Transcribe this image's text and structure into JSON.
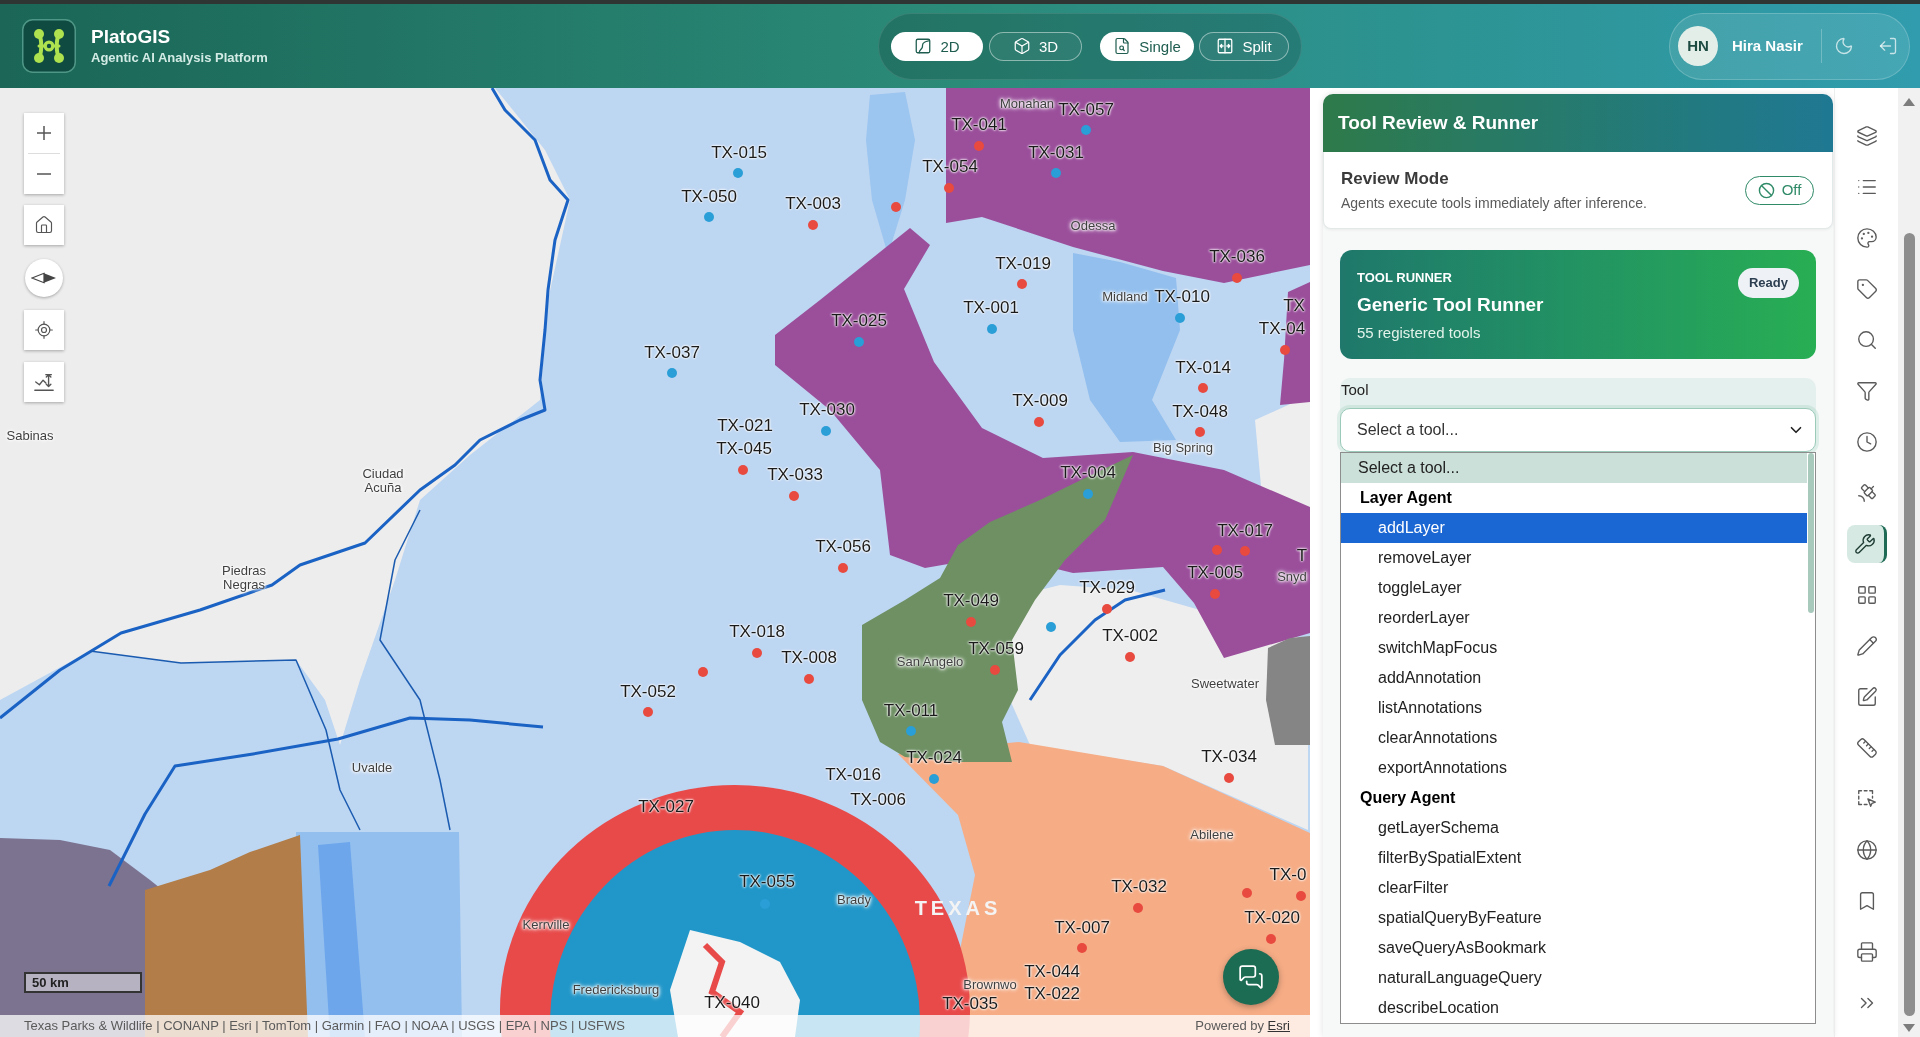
{
  "header": {
    "app_name": "PlatoGIS",
    "tagline": "Agentic AI Analysis Platform",
    "view_modes": [
      {
        "label": "2D",
        "selected": true
      },
      {
        "label": "3D",
        "selected": false
      }
    ],
    "layout_modes": [
      {
        "label": "Single",
        "selected": true
      },
      {
        "label": "Split",
        "selected": false
      }
    ],
    "user": {
      "initials": "HN",
      "name": "Hira Nasir"
    }
  },
  "map": {
    "points": [
      {
        "label": "TX-057",
        "color": "#2a9ed6"
      },
      {
        "label": "TX-041",
        "color": "#e84a3f"
      },
      {
        "label": "TX-015",
        "color": "#2a9ed6"
      },
      {
        "label": "TX-031",
        "color": "#2a9ed6"
      },
      {
        "label": "TX-054",
        "color": "#e84a3f"
      },
      {
        "label": "TX-050",
        "color": "#2a9ed6"
      },
      {
        "label": "TX-003",
        "color": "#e84a3f"
      },
      {
        "color": "#e84a3f"
      },
      {
        "label": "TX-036",
        "color": "#e84a3f"
      },
      {
        "label": "TX-019",
        "color": "#e84a3f"
      },
      {
        "label": "TX-010",
        "color": "#2a9ed6"
      },
      {
        "label": "TX"
      },
      {
        "label": "TX-001",
        "color": "#2a9ed6"
      },
      {
        "label": "TX-025",
        "color": "#2a9ed6"
      },
      {
        "label": "TX-04",
        "color": "#e84a3f"
      },
      {
        "label": "TX-037",
        "color": "#2a9ed6"
      },
      {
        "label": "TX-014",
        "color": "#e84a3f"
      },
      {
        "label": "TX-009",
        "color": "#e84a3f"
      },
      {
        "label": "TX-030",
        "color": "#2a9ed6"
      },
      {
        "label": "TX-048",
        "color": "#e84a3f"
      },
      {
        "label": "TX-021"
      },
      {
        "label": "TX-045",
        "color": "#e84a3f"
      },
      {
        "label": "TX-004",
        "color": "#2a9ed6"
      },
      {
        "label": "TX-033",
        "color": "#e84a3f"
      },
      {
        "label": "TX-017",
        "color": "#e84a3f"
      },
      {
        "color": "#e84a3f"
      },
      {
        "label": "TX-056",
        "color": "#e84a3f"
      },
      {
        "label": "T"
      },
      {
        "label": "TX-005",
        "color": "#e84a3f"
      },
      {
        "label": "TX-029",
        "color": "#e84a3f"
      },
      {
        "label": "TX-049",
        "color": "#e84a3f"
      },
      {
        "color": "#2a9ed6"
      },
      {
        "label": "TX-018",
        "color": "#e84a3f"
      },
      {
        "label": "TX-002",
        "color": "#e84a3f"
      },
      {
        "label": "TX-059",
        "color": "#e84a3f"
      },
      {
        "label": "TX-008",
        "color": "#e84a3f"
      },
      {
        "color": "#e84a3f"
      },
      {
        "label": "TX-052",
        "color": "#e84a3f"
      },
      {
        "label": "TX-011",
        "color": "#2a9ed6"
      },
      {
        "label": "TX-034",
        "color": "#e84a3f"
      },
      {
        "label": "TX-024",
        "color": "#2a9ed6"
      },
      {
        "label": "TX-016"
      },
      {
        "label": "TX-006"
      },
      {
        "label": "TX-027"
      },
      {
        "label": "TX-0",
        "color": "#e84a3f"
      },
      {
        "color": "#e84a3f"
      },
      {
        "label": "TX-055",
        "color": "#2a9ed6"
      },
      {
        "label": "TX-032",
        "color": "#e84a3f"
      },
      {
        "label": "TX-020",
        "color": "#e84a3f"
      },
      {
        "label": "TX-007",
        "color": "#e84a3f"
      },
      {
        "label": "TX-044"
      },
      {
        "label": "TX-022"
      },
      {
        "label": "TX-035"
      },
      {
        "label": "TX-040"
      }
    ],
    "places": [
      {
        "kind": "city",
        "name": "Monahan"
      },
      {
        "kind": "city",
        "name": "Odessa"
      },
      {
        "kind": "city",
        "name": "Midland"
      },
      {
        "kind": "city",
        "name": "Sabinas"
      },
      {
        "kind": "city",
        "name": "Big Spring"
      },
      {
        "kind": "city",
        "name": "Ciudad Acuña"
      },
      {
        "kind": "city",
        "name": "Piedras Negras"
      },
      {
        "kind": "city",
        "name": "Snyd"
      },
      {
        "kind": "city",
        "name": "San Angelo"
      },
      {
        "kind": "city",
        "name": "Sweetwater"
      },
      {
        "kind": "city",
        "name": "Uvalde"
      },
      {
        "kind": "city",
        "name": "Abilene"
      },
      {
        "kind": "region",
        "name": "TEXAS"
      },
      {
        "kind": "city",
        "name": "Brady"
      },
      {
        "kind": "city",
        "name": "Kerrville"
      },
      {
        "kind": "city",
        "name": "Brownwo"
      },
      {
        "kind": "city",
        "name": "Fredericksburg"
      }
    ],
    "scale_label": "50 km",
    "attribution": "Texas Parks & Wildlife | CONANP | Esri | TomTom | Garmin | FAO | NOAA | USGS | EPA | NPS | USFWS",
    "powered_by": "Powered by",
    "powered_by_link": "Esri"
  },
  "panel": {
    "title": "Tool Review & Runner",
    "review_mode": {
      "title": "Review Mode",
      "description": "Agents execute tools immediately after inference.",
      "on": false,
      "toggle_label": "Off"
    },
    "runner": {
      "eyebrow": "TOOL RUNNER",
      "title": "Generic Tool Runner",
      "subtitle": "55 registered tools",
      "status": "Ready"
    },
    "tool_field": {
      "label": "Tool",
      "placeholder": "Select a tool...",
      "expanded": true
    },
    "tool_options": [
      {
        "kind": "option",
        "label": "Select a tool...",
        "selected": true,
        "highlighted": false
      },
      {
        "kind": "group",
        "label": "Layer Agent",
        "children": [
          {
            "kind": "option",
            "label": "addLayer",
            "selected": false,
            "highlighted": true
          },
          {
            "kind": "option",
            "label": "removeLayer",
            "selected": false,
            "highlighted": false
          },
          {
            "kind": "option",
            "label": "toggleLayer",
            "selected": false,
            "highlighted": false
          },
          {
            "kind": "option",
            "label": "reorderLayer",
            "selected": false,
            "highlighted": false
          },
          {
            "kind": "option",
            "label": "switchMapFocus",
            "selected": false,
            "highlighted": false
          },
          {
            "kind": "option",
            "label": "addAnnotation",
            "selected": false,
            "highlighted": false
          },
          {
            "kind": "option",
            "label": "listAnnotations",
            "selected": false,
            "highlighted": false
          },
          {
            "kind": "option",
            "label": "clearAnnotations",
            "selected": false,
            "highlighted": false
          },
          {
            "kind": "option",
            "label": "exportAnnotations",
            "selected": false,
            "highlighted": false
          }
        ]
      },
      {
        "kind": "group",
        "label": "Query Agent",
        "children": [
          {
            "kind": "option",
            "label": "getLayerSchema",
            "selected": false,
            "highlighted": false
          },
          {
            "kind": "option",
            "label": "filterBySpatialExtent",
            "selected": false,
            "highlighted": false
          },
          {
            "kind": "option",
            "label": "clearFilter",
            "selected": false,
            "highlighted": false
          },
          {
            "kind": "option",
            "label": "spatialQueryByFeature",
            "selected": false,
            "highlighted": false
          },
          {
            "kind": "option",
            "label": "saveQueryAsBookmark",
            "selected": false,
            "highlighted": false
          },
          {
            "kind": "option",
            "label": "naturalLanguageQuery",
            "selected": false,
            "highlighted": false
          },
          {
            "kind": "option",
            "label": "describeLocation",
            "selected": false,
            "highlighted": false
          }
        ]
      }
    ]
  },
  "rail": [
    {
      "selected": false
    },
    {
      "selected": false
    },
    {
      "selected": false
    },
    {
      "selected": false
    },
    {
      "selected": false
    },
    {
      "selected": false
    },
    {
      "selected": false
    },
    {
      "selected": false
    },
    {
      "selected": true
    },
    {
      "selected": false
    },
    {
      "selected": false
    },
    {
      "selected": false
    },
    {
      "selected": false
    },
    {
      "selected": false
    },
    {
      "selected": false
    },
    {
      "selected": false
    },
    {
      "selected": false
    },
    {
      "selected": false
    }
  ]
}
